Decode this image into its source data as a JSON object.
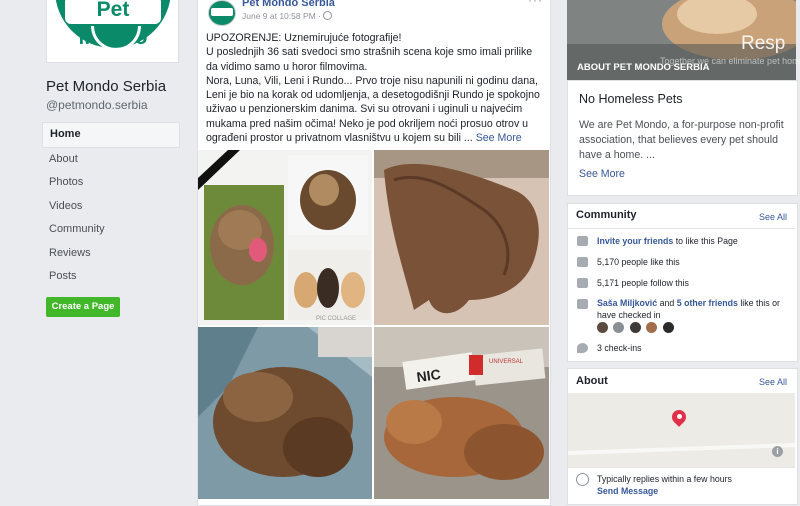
{
  "brand": {
    "logo_text": "Pet Mondo",
    "page_name": "Pet Mondo Serbia",
    "handle": "@petmondo.serbia",
    "accent": "#0b8a6a",
    "link_color": "#365899",
    "green_button": "#42b72a"
  },
  "nav": {
    "items": [
      {
        "label": "Home",
        "active": true
      },
      {
        "label": "About"
      },
      {
        "label": "Photos"
      },
      {
        "label": "Videos"
      },
      {
        "label": "Community"
      },
      {
        "label": "Reviews"
      },
      {
        "label": "Posts"
      }
    ],
    "create_page": "Create a Page"
  },
  "post": {
    "author": "Pet Mondo Serbia",
    "date": "June 9 at 10:58 PM",
    "date_separator": "·",
    "more": "···",
    "text_lines": [
      "UPOZORENJE: Uznemirujuće fotografije!",
      "U poslednjih 36 sati svedoci smo strašnih scena koje smo imali prilike",
      "da vidimo samo u horor filmovima.",
      "Nora, Luna, Vili, Leni i Rundo... Prvo troje nisu napunili ni godinu dana,",
      "Leni je bio na korak od udomljenja, a desetogodišnji Rundo je spokojno",
      "uživao u penzionerskim danima. Svi su otrovani i uginuli u najvećim",
      "mukama pred našim očima! Neko je pod okriljem noći prosuo otrov u",
      "ograđeni prostor u privatnom vlasništvu u kojem su bili"
    ],
    "ellipsis": "...",
    "see_more": "See More",
    "photo_labels": {
      "collage": "PIC COLLAGE",
      "bag1": "NIC",
      "bag2": "UNIVERSAL"
    }
  },
  "cover": {
    "caption": "ABOUT PET MONDO SERBIA",
    "overlay_text": "Resp",
    "overlay_small": "Together we can eliminate pet homeless"
  },
  "about": {
    "title": "No Homeless Pets",
    "description": "We are Pet Mondo, a for-purpose non-profit association, that believes every pet should have a home. ...",
    "see_more": "See More"
  },
  "community": {
    "title": "Community",
    "see_all": "See All",
    "invite_link": "Invite your friends",
    "invite_rest": "to like this Page",
    "likes": "5,170 people like this",
    "follows": "5,171 people follow this",
    "friend": "Saša Miljković",
    "and": "and",
    "others": "5 other friends",
    "friend_rest": "like this or",
    "friend_rest2": "have checked in",
    "checkins": "3 check-ins"
  },
  "about_box": {
    "title": "About",
    "see_all": "See All",
    "reply": "Typically replies within a few hours",
    "send": "Send Message",
    "info": "i"
  }
}
